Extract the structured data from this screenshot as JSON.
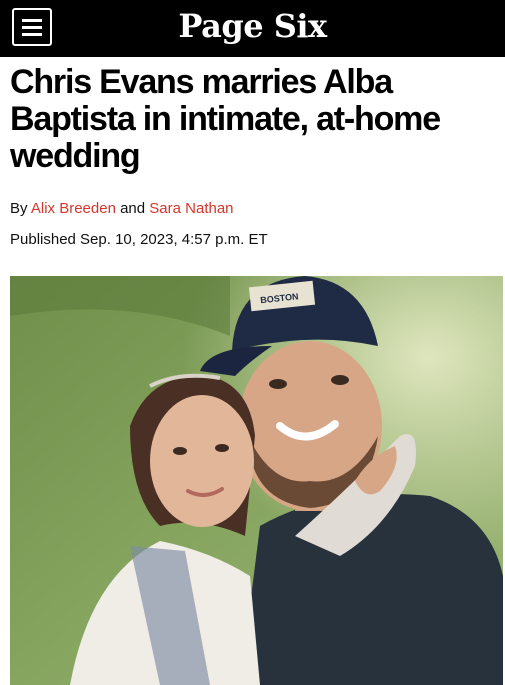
{
  "header": {
    "logo": "Page Six",
    "menu_icon": "hamburger-menu-icon"
  },
  "article": {
    "headline": "Chris Evans marries Alba Baptista in intimate, at-home wedding",
    "byline_prefix": "By",
    "byline_joiner": "and",
    "authors": [
      "Alix Breeden",
      "Sara Nathan"
    ],
    "published": "Published Sep. 10, 2023, 4:57 p.m. ET",
    "cap_text": "BOSTON",
    "colors": {
      "author_link": "#d4372c",
      "topbar": "#000000"
    }
  }
}
